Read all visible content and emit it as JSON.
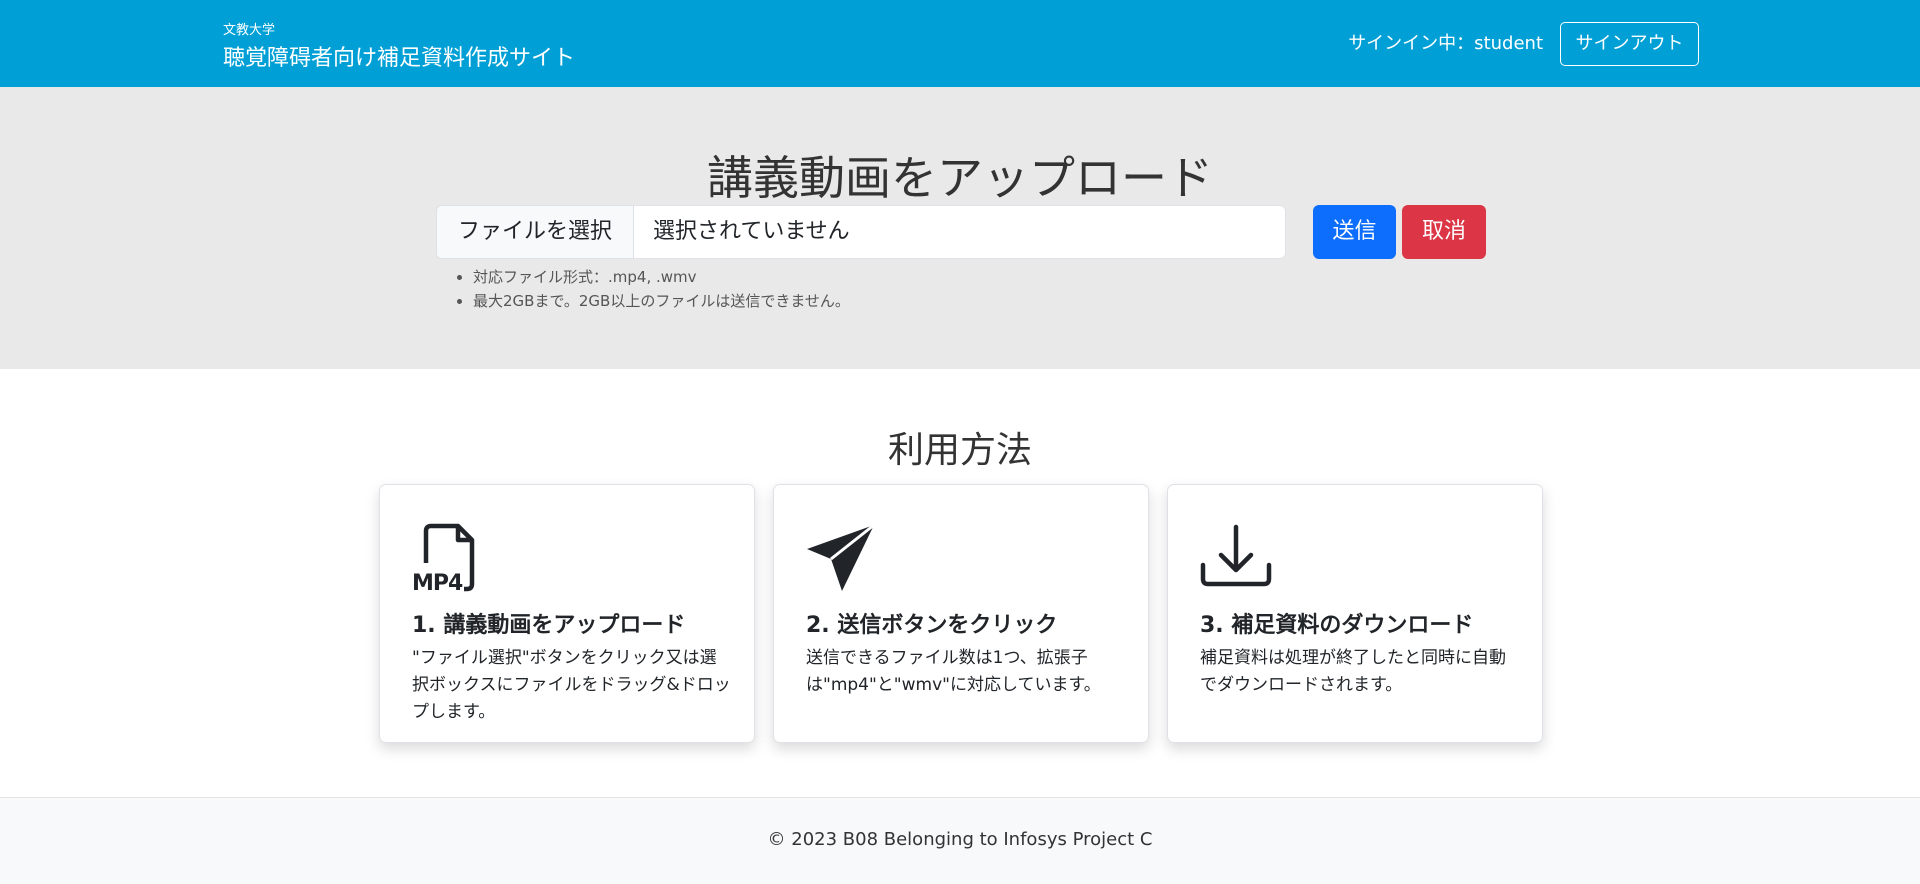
{
  "header": {
    "org": "文教大学",
    "site_title": "聴覚障碍者向け補足資料作成サイト",
    "signin_status": "サインイン中：student",
    "signout_label": "サインアウト"
  },
  "upload": {
    "title": "講義動画をアップロード",
    "file_button": "ファイルを選択",
    "file_status": "選択されていません",
    "send_label": "送信",
    "cancel_label": "取消",
    "notes": [
      "対応ファイル形式：.mp4, .wmv",
      "最大2GBまで。2GB以上のファイルは送信できません。"
    ]
  },
  "howto": {
    "title": "利用方法",
    "cards": [
      {
        "icon": "mp4-file-icon",
        "title": "1. 講義動画をアップロード",
        "text": "\"ファイル選択\"ボタンをクリック又は選択ボックスにファイルをドラッグ&ドロップします。"
      },
      {
        "icon": "send-icon",
        "title": "2. 送信ボタンをクリック",
        "text": "送信できるファイル数は1つ、拡張子は\"mp4\"と\"wmv\"に対応しています。"
      },
      {
        "icon": "download-icon",
        "title": "3. 補足資料のダウンロード",
        "text": "補足資料は処理が終了したと同時に自動でダウンロードされます。"
      }
    ]
  },
  "footer": {
    "text": "© 2023 B08 Belonging to Infosys Project C"
  },
  "colors": {
    "navbar": "#00a0d6",
    "send": "#0d6efd",
    "cancel": "#dc3545",
    "hero_bg": "#e9e9e9"
  }
}
